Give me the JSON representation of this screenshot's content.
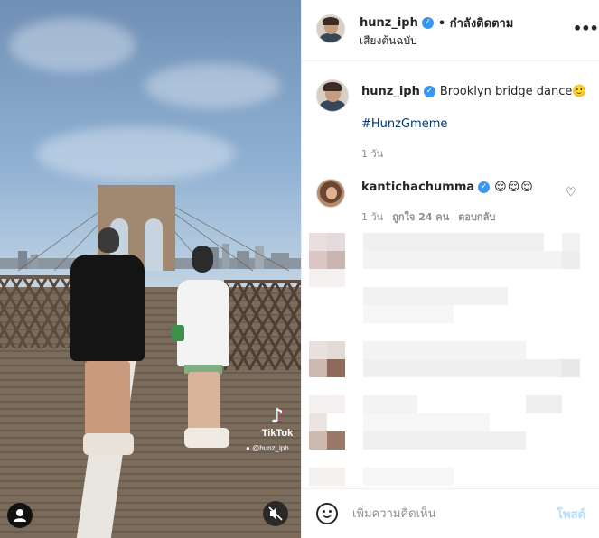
{
  "post": {
    "author": {
      "username": "hunz_iph",
      "verified_icon": "verified-badge-icon",
      "follow_status": "• กำลังติดตาม",
      "audio": "เสียงต้นฉบับ"
    },
    "caption": {
      "username": "hunz_iph",
      "text": "Brooklyn bridge dance🙂",
      "hashtag": "#HunzGmeme",
      "time": "1 วัน"
    },
    "comments": [
      {
        "username": "kantichachumma",
        "text": "😌😌😌",
        "time": "1 วัน",
        "likes": "ถูกใจ 24 คน",
        "reply": "ตอบกลับ"
      }
    ]
  },
  "media": {
    "watermark": "TikTok",
    "watermark_handle": "@hunz_iph",
    "icons": [
      "tiktok-icon",
      "user-tag-icon",
      "mute-icon"
    ]
  },
  "composer": {
    "placeholder": "เพิ่มความคิดเห็น",
    "post_label": "โพสต์"
  },
  "colors": {
    "verified": "#3897f0",
    "hashtag": "#00376b",
    "post_button_disabled": "#b2dffc",
    "muted_text": "#8e8e8e"
  }
}
